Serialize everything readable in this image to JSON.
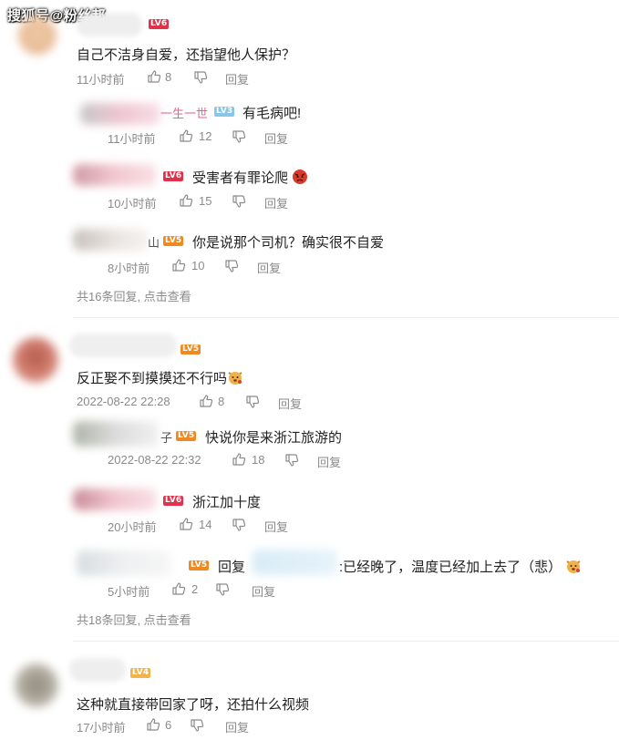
{
  "watermark": "搜狐号@粉丝邦",
  "colors": {
    "accent_lv6": "#e2314a",
    "accent_lv5": "#ee8a22",
    "accent_lv3": "#86c6ea",
    "meta": "#8a8a8a"
  },
  "threads": [
    {
      "name_tail": "",
      "level": "LV6",
      "text": "自己不洁身自爱，还指望他人保护？",
      "time": "11小时前",
      "likes": "8",
      "reply": "回复",
      "replies": [
        {
          "name_tail": "一生一世",
          "level": "LV3",
          "text": "有毛病吧!",
          "time": "11小时前",
          "likes": "12",
          "reply": "回复"
        },
        {
          "name_tail": "",
          "level": "LV6",
          "text": "受害者有罪论爬",
          "time": "10小时前",
          "likes": "15",
          "reply": "回复"
        },
        {
          "name_tail": "山",
          "level": "LV5",
          "text": "你是说那个司机？确实很不自爱",
          "time": "8小时前",
          "likes": "10",
          "reply": "回复"
        }
      ],
      "more": "共16条回复, 点击查看"
    },
    {
      "level": "LV5",
      "text": "反正娶不到摸摸还不行吗",
      "time": "2022-08-22 22:28",
      "likes": "8",
      "reply": "回复",
      "replies": [
        {
          "name_tail": "子",
          "level": "LV5",
          "text": "快说你是来浙江旅游的",
          "time": "2022-08-22 22:32",
          "likes": "18",
          "reply": "回复"
        },
        {
          "name_tail": "",
          "level": "LV6",
          "text": "浙江加十度",
          "time": "20小时前",
          "likes": "14",
          "reply": "回复"
        },
        {
          "name_tail": "",
          "level": "LV5",
          "reply_prefix": "回复",
          "text": ":已经晚了，温度已经加上去了（悲）",
          "time": "5小时前",
          "likes": "2",
          "reply": "回复"
        }
      ],
      "more": "共18条回复, 点击查看"
    },
    {
      "level": "LV4",
      "text": "这种就直接带回家了呀，还拍什么视频",
      "time": "17小时前",
      "likes": "6",
      "reply": "回复"
    }
  ]
}
